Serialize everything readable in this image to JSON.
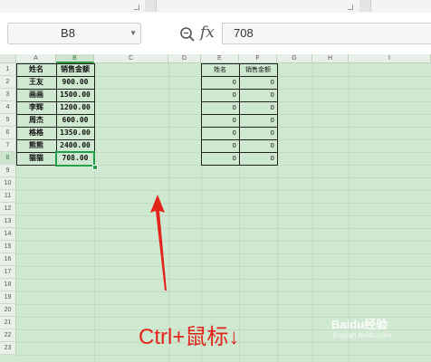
{
  "formula_bar": {
    "cell_reference": "B8",
    "formula_icon": "fx",
    "formula_value": "708"
  },
  "columns": [
    "A",
    "B",
    "C",
    "D",
    "E",
    "F",
    "G",
    "H",
    "I"
  ],
  "rows": [
    "1",
    "2",
    "3",
    "4",
    "5",
    "6",
    "7",
    "8",
    "9",
    "10",
    "11",
    "12",
    "13",
    "14",
    "15",
    "16",
    "17",
    "18",
    "19",
    "20",
    "21",
    "22",
    "23"
  ],
  "table1": {
    "header": {
      "name": "姓名",
      "amount": "销售金额"
    },
    "rows": [
      {
        "name": "王友",
        "amount": "900.00"
      },
      {
        "name": "画画",
        "amount": "1500.00"
      },
      {
        "name": "李辉",
        "amount": "1200.00"
      },
      {
        "name": "周杰",
        "amount": "600.00"
      },
      {
        "name": "格格",
        "amount": "1350.00"
      },
      {
        "name": "熊熊",
        "amount": "2400.00"
      },
      {
        "name": "猫猫",
        "amount": "708.00"
      }
    ]
  },
  "table2": {
    "header": {
      "name": "姓名",
      "amount": "销售金额"
    },
    "rows": [
      {
        "name": "0",
        "amount": "0"
      },
      {
        "name": "0",
        "amount": "0"
      },
      {
        "name": "0",
        "amount": "0"
      },
      {
        "name": "0",
        "amount": "0"
      },
      {
        "name": "0",
        "amount": "0"
      },
      {
        "name": "0",
        "amount": "0"
      },
      {
        "name": "0",
        "amount": "0"
      }
    ]
  },
  "annotation": "Ctrl+鼠标↓",
  "watermark": {
    "brand": "Baidu经验",
    "url": "jingyan.baidu.com"
  },
  "colors": {
    "grid_bg": "#cfe8d0",
    "selection": "#22a04a",
    "annotation": "#e3241b"
  }
}
